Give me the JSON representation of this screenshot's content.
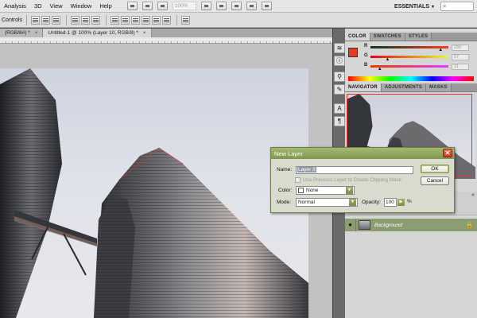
{
  "menu": {
    "items": [
      "Analysis",
      "3D",
      "View",
      "Window",
      "Help"
    ],
    "zoom_value": "100%",
    "workspace": "ESSENTIALS",
    "workspace_arrow": "▾",
    "search_icon": "⌕"
  },
  "options_bar": {
    "show_transform_controls": "Controls"
  },
  "doc_tabs": [
    {
      "label": "(RGB/8#) *",
      "close": "×"
    },
    {
      "label": "Untitled-1 @ 100% (Layer 10, RGB/8) *",
      "close": "×"
    }
  ],
  "panels": {
    "color_tabs": [
      "COLOR",
      "SWATCHES",
      "STYLES"
    ],
    "color": {
      "sliders": [
        {
          "label": "R",
          "value": "230",
          "pos": 0.9
        },
        {
          "label": "G",
          "value": "57",
          "pos": 0.22
        },
        {
          "label": "B",
          "value": "31",
          "pos": 0.12
        }
      ],
      "foreground_color": "#e63b1f"
    },
    "navigator_tabs": [
      "NAVIGATOR",
      "ADJUSTMENTS",
      "MASKS"
    ],
    "layer": {
      "name": "Background",
      "visibility_icon": "eye-icon",
      "lock_icon": "lock-icon"
    },
    "collapse_glyph": "«"
  },
  "dialog": {
    "title": "New Layer",
    "close_glyph": "✕",
    "name_label": "Name:",
    "name_value": "Layer 8",
    "clip_label": "Use Previous Layer to Create Clipping Mask",
    "color_label": "Color:",
    "color_value": "None",
    "mode_label": "Mode:",
    "mode_value": "Normal",
    "opacity_label": "Opacity:",
    "opacity_value": "100",
    "opacity_unit": "%",
    "ok_label": "OK",
    "cancel_label": "Cancel"
  },
  "colors": {
    "dialog_accent": "#8c9d71",
    "highlight_red": "#e8332c"
  }
}
